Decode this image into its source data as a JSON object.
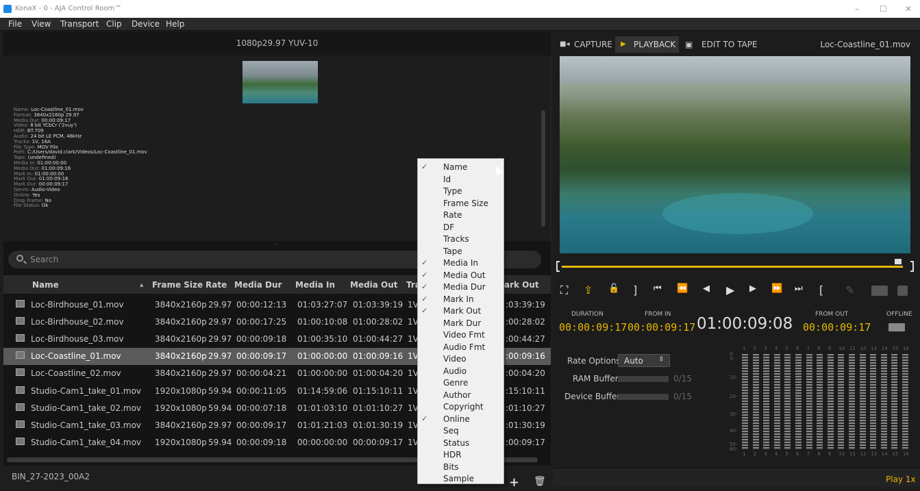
{
  "window": {
    "title": "KonaX - 0 - AJA Control Room™",
    "min": "–",
    "max": "☐",
    "close": "✕"
  },
  "menu": [
    "File",
    "View",
    "Transport",
    "Clip",
    "Device",
    "Help"
  ],
  "format": "1080p29.97 YUV-10",
  "clip_info": [
    {
      "k": "Name: ",
      "v": "Loc-Coastline_01.mov"
    },
    {
      "k": "Format: ",
      "v": "3840x2160p 29.97"
    },
    {
      "k": "Media Dur: ",
      "v": "00:00:09:17"
    },
    {
      "k": "Video: ",
      "v": "8 bit YCbCr ('2vuy')"
    },
    {
      "k": "HDR: ",
      "v": "BT.709"
    },
    {
      "k": "Audio: ",
      "v": "24 bit LE PCM, 48kHz"
    },
    {
      "k": "Tracks: ",
      "v": "1V, 16A"
    },
    {
      "k": "File Type: ",
      "v": "MOV File"
    },
    {
      "k": "Path: ",
      "v": "C:/Users/david.clark/Videos/Loc-Coastline_01.mov"
    },
    {
      "k": "Tape: ",
      "v": "(undefined)"
    },
    {
      "k": "Media In: ",
      "v": "01:00:00:00"
    },
    {
      "k": "Media Out: ",
      "v": "01:00:09:16"
    },
    {
      "k": "Mark In: ",
      "v": "01:00:00:00"
    },
    {
      "k": "Mark Out: ",
      "v": "01:00:09:16"
    },
    {
      "k": "Mark Dur: ",
      "v": "00:00:09:17"
    },
    {
      "k": "Genre: ",
      "v": "Audio-Video"
    },
    {
      "k": "Online: ",
      "v": "Yes"
    },
    {
      "k": "Drop Frame: ",
      "v": "No"
    },
    {
      "k": "File Status: ",
      "v": "Ok"
    }
  ],
  "search": {
    "placeholder": "Search",
    "divider": "..."
  },
  "table": {
    "headers": {
      "name": "Name",
      "frame_size": "Frame Size",
      "rate": "Rate",
      "media_dur": "Media Dur",
      "media_in": "Media In",
      "media_out": "Media Out",
      "tracks": "Tra",
      "mark_out": "ark Out"
    },
    "sort_arrow": "▲",
    "rows": [
      {
        "name": "Loc-Birdhouse_01.mov",
        "size": "3840x2160p",
        "rate": "29.97",
        "dur": "00:00:12:13",
        "in": "01:03:27:07",
        "out": "01:03:39:19",
        "tr": "1V,",
        "mo": ":03:39:19"
      },
      {
        "name": "Loc-Birdhouse_02.mov",
        "size": "3840x2160p",
        "rate": "29.97",
        "dur": "00:00:17:25",
        "in": "01:00:10:08",
        "out": "01:00:28:02",
        "tr": "1V,",
        "mo": ":00:28:02"
      },
      {
        "name": "Loc-Birdhouse_03.mov",
        "size": "3840x2160p",
        "rate": "29.97",
        "dur": "00:00:09:18",
        "in": "01:00:35:10",
        "out": "01:00:44:27",
        "tr": "1V,",
        "mo": ":00:44:27"
      },
      {
        "name": "Loc-Coastline_01.mov",
        "size": "3840x2160p",
        "rate": "29.97",
        "dur": "00:00:09:17",
        "in": "01:00:00:00",
        "out": "01:00:09:16",
        "tr": "1V,",
        "mo": ":00:09:16"
      },
      {
        "name": "Loc-Coastline_02.mov",
        "size": "3840x2160p",
        "rate": "29.97",
        "dur": "00:00:04:21",
        "in": "01:00:00:00",
        "out": "01:00:04:20",
        "tr": "1V,",
        "mo": ":00:04:20"
      },
      {
        "name": "Studio-Cam1_take_01.mov",
        "size": "1920x1080p",
        "rate": "59.94",
        "dur": "00:00:11:05",
        "in": "01:14:59:06",
        "out": "01:15:10:11",
        "tr": "1V,",
        "mo": ":15:10:11"
      },
      {
        "name": "Studio-Cam1_take_02.mov",
        "size": "1920x1080p",
        "rate": "59.94",
        "dur": "00:00:07:18",
        "in": "01:01:03:10",
        "out": "01:01:10:27",
        "tr": "1V,",
        "mo": ":01:10:27"
      },
      {
        "name": "Studio-Cam1_take_03.mov",
        "size": "3840x2160p",
        "rate": "29.97",
        "dur": "00:00:09:17",
        "in": "01:01:21:03",
        "out": "01:01:30:19",
        "tr": "1V,",
        "mo": ":01:30:19"
      },
      {
        "name": "Studio-Cam1_take_04.mov",
        "size": "1920x1080p",
        "rate": "59.94",
        "dur": "00:00:09:18",
        "in": "00:00:00:00",
        "out": "00:00:09:17",
        "tr": "1V,",
        "mo": ":00:09:17"
      }
    ],
    "selected_index": 3
  },
  "bin_name": "BIN_27-2023_00A2",
  "bottom_icons": {
    "add": "+",
    "delete": "🗑"
  },
  "context_menu": {
    "check_glyph": "✓",
    "items": [
      {
        "label": "Name",
        "checked": true
      },
      {
        "label": "Id",
        "checked": false
      },
      {
        "label": "Type",
        "checked": false
      },
      {
        "label": "Frame Size",
        "checked": false
      },
      {
        "label": "Rate",
        "checked": false
      },
      {
        "label": "DF",
        "checked": false
      },
      {
        "label": "Tracks",
        "checked": false
      },
      {
        "label": "Tape",
        "checked": false
      },
      {
        "label": "Media In",
        "checked": true
      },
      {
        "label": "Media Out",
        "checked": true
      },
      {
        "label": "Media Dur",
        "checked": true
      },
      {
        "label": "Mark In",
        "checked": true
      },
      {
        "label": "Mark Out",
        "checked": true
      },
      {
        "label": "Mark Dur",
        "checked": false
      },
      {
        "label": "Video Fmt",
        "checked": false
      },
      {
        "label": "Audio Fmt",
        "checked": false
      },
      {
        "label": "Video",
        "checked": false
      },
      {
        "label": "Audio",
        "checked": false
      },
      {
        "label": "Genre",
        "checked": false
      },
      {
        "label": "Author",
        "checked": false
      },
      {
        "label": "Copyright",
        "checked": false
      },
      {
        "label": "Online",
        "checked": true
      },
      {
        "label": "Seq",
        "checked": false
      },
      {
        "label": "Status",
        "checked": false
      },
      {
        "label": "HDR",
        "checked": false
      },
      {
        "label": "Bits",
        "checked": false
      },
      {
        "label": "Sample",
        "checked": false
      }
    ]
  },
  "right": {
    "tabs": {
      "capture": "CAPTURE",
      "playback": "PLAYBACK",
      "edit": "EDIT TO TAPE"
    },
    "tab_icons": {
      "capture": "■◂",
      "playback": "▶",
      "edit": "▣"
    },
    "clip_name": "Loc-Coastline_01.mov",
    "transport_glyphs": [
      "⛶",
      "⇪",
      "🔓",
      "]",
      "⏮",
      "⏪",
      "◀",
      "▶",
      "▶",
      "⏩",
      "⏭",
      "[",
      "✎"
    ],
    "labels": {
      "duration": "DURATION",
      "from_in": "FROM IN",
      "from_out": "FROM OUT",
      "offline": "OFFLINE"
    },
    "timecodes": {
      "duration": "00:00:09:17",
      "from_in": "00:00:09:17",
      "current": "01:00:09:08",
      "from_out": "00:00:09:17"
    },
    "rate_options": {
      "label": "Rate Options",
      "value": "Auto",
      "arrow": "⇕"
    },
    "ram_buffer": {
      "label": "RAM Buffer",
      "value": "0/15"
    },
    "device_buffer": {
      "label": "Device Buffer",
      "value": "0/15"
    },
    "meter_scale": [
      "0-",
      "3-",
      "10-",
      "20-",
      "30-",
      "40-",
      "50-",
      "60-"
    ],
    "meter_channels": [
      "1",
      "2",
      "3",
      "4",
      "5",
      "6",
      "7",
      "8",
      "9",
      "10",
      "11",
      "12",
      "13",
      "14",
      "15",
      "16"
    ],
    "play_rate": "Play 1x"
  },
  "colors": {
    "accent": "#e6b800",
    "selection": "#5a5a5a"
  }
}
